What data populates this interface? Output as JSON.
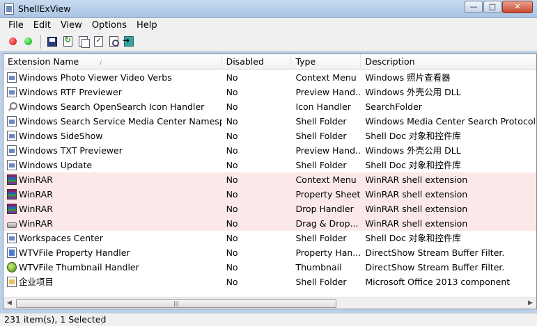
{
  "window": {
    "title": "ShellExView",
    "minimize": "—",
    "maximize": "□",
    "close": "✕"
  },
  "menu": [
    "File",
    "Edit",
    "View",
    "Options",
    "Help"
  ],
  "columns": [
    "Extension Name",
    "Disabled",
    "Type",
    "Description"
  ],
  "sort_indicator": "/",
  "rows": [
    {
      "icon": "dll-icon",
      "name": "Windows Photo Viewer Video Verbs",
      "disabled": "No",
      "type": "Context Menu",
      "description": "Windows 照片查看器",
      "highlight": false
    },
    {
      "icon": "dll-icon",
      "name": "Windows RTF Previewer",
      "disabled": "No",
      "type": "Preview Hand...",
      "description": "Windows 外壳公用 DLL",
      "highlight": false
    },
    {
      "icon": "search-icon",
      "name": "Windows Search OpenSearch Icon Handler",
      "disabled": "No",
      "type": "Icon Handler",
      "description": "SearchFolder",
      "highlight": false
    },
    {
      "icon": "dll-icon",
      "name": "Windows Search Service Media Center Namesp...",
      "disabled": "No",
      "type": "Shell Folder",
      "description": "Windows Media Center Search Protocol",
      "highlight": false
    },
    {
      "icon": "dll-icon",
      "name": "Windows SideShow",
      "disabled": "No",
      "type": "Shell Folder",
      "description": "Shell Doc 对象和控件库",
      "highlight": false
    },
    {
      "icon": "dll-icon",
      "name": "Windows TXT Previewer",
      "disabled": "No",
      "type": "Preview Hand...",
      "description": "Windows 外壳公用 DLL",
      "highlight": false
    },
    {
      "icon": "dll-icon",
      "name": "Windows Update",
      "disabled": "No",
      "type": "Shell Folder",
      "description": "Shell Doc 对象和控件库",
      "highlight": false
    },
    {
      "icon": "winrar-icon",
      "name": "WinRAR",
      "disabled": "No",
      "type": "Context Menu",
      "description": "WinRAR shell extension",
      "highlight": true
    },
    {
      "icon": "winrar-icon",
      "name": "WinRAR",
      "disabled": "No",
      "type": "Property Sheet",
      "description": "WinRAR shell extension",
      "highlight": true
    },
    {
      "icon": "winrar-icon",
      "name": "WinRAR",
      "disabled": "No",
      "type": "Drop Handler",
      "description": "WinRAR shell extension",
      "highlight": true
    },
    {
      "icon": "drive-icon",
      "name": "WinRAR",
      "disabled": "No",
      "type": "Drag & Drop...",
      "description": "WinRAR shell extension",
      "highlight": true
    },
    {
      "icon": "dll-icon",
      "name": "Workspaces Center",
      "disabled": "No",
      "type": "Shell Folder",
      "description": "Shell Doc 对象和控件库",
      "highlight": false
    },
    {
      "icon": "wtv-icon",
      "name": "WTVFile Property Handler",
      "disabled": "No",
      "type": "Property Han...",
      "description": "DirectShow Stream Buffer Filter.",
      "highlight": false
    },
    {
      "icon": "wtv-thumbnail-icon",
      "name": "WTVFile Thumbnail Handler",
      "disabled": "No",
      "type": "Thumbnail",
      "description": "DirectShow Stream Buffer Filter.",
      "highlight": false
    },
    {
      "icon": "folder-doc-icon",
      "name": "企业项目",
      "disabled": "No",
      "type": "Shell Folder",
      "description": "Microsoft Office 2013 component",
      "highlight": false
    }
  ],
  "scrollbar": {
    "left_arrow": "◀",
    "right_arrow": "▶",
    "grip": "|||"
  },
  "status": {
    "text": "231 item(s), 1 Selected"
  }
}
